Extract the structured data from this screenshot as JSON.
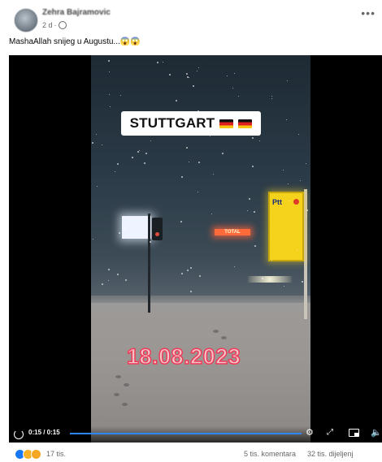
{
  "post": {
    "author": "Zehra Bajramovic",
    "time": "2 d",
    "privacy_icon": "globe-icon",
    "more_icon": "•••",
    "caption": "MashaAllah snijeg u Augustu...😱😱"
  },
  "video": {
    "overlay_city": "STUTTGART",
    "overlay_flags": "flag-germany-icon x2",
    "overlay_date": "18.08.2023",
    "sign_text": "Ptt",
    "neon_text": "TOTAL",
    "timecode": "0:15 / 0:15",
    "progress": 1.0,
    "accent_color": "#2d88ff"
  },
  "engagement": {
    "reaction_count": "17 tis.",
    "comments": "5 tis. komentara",
    "shares": "32 tis. dijeljenj"
  }
}
